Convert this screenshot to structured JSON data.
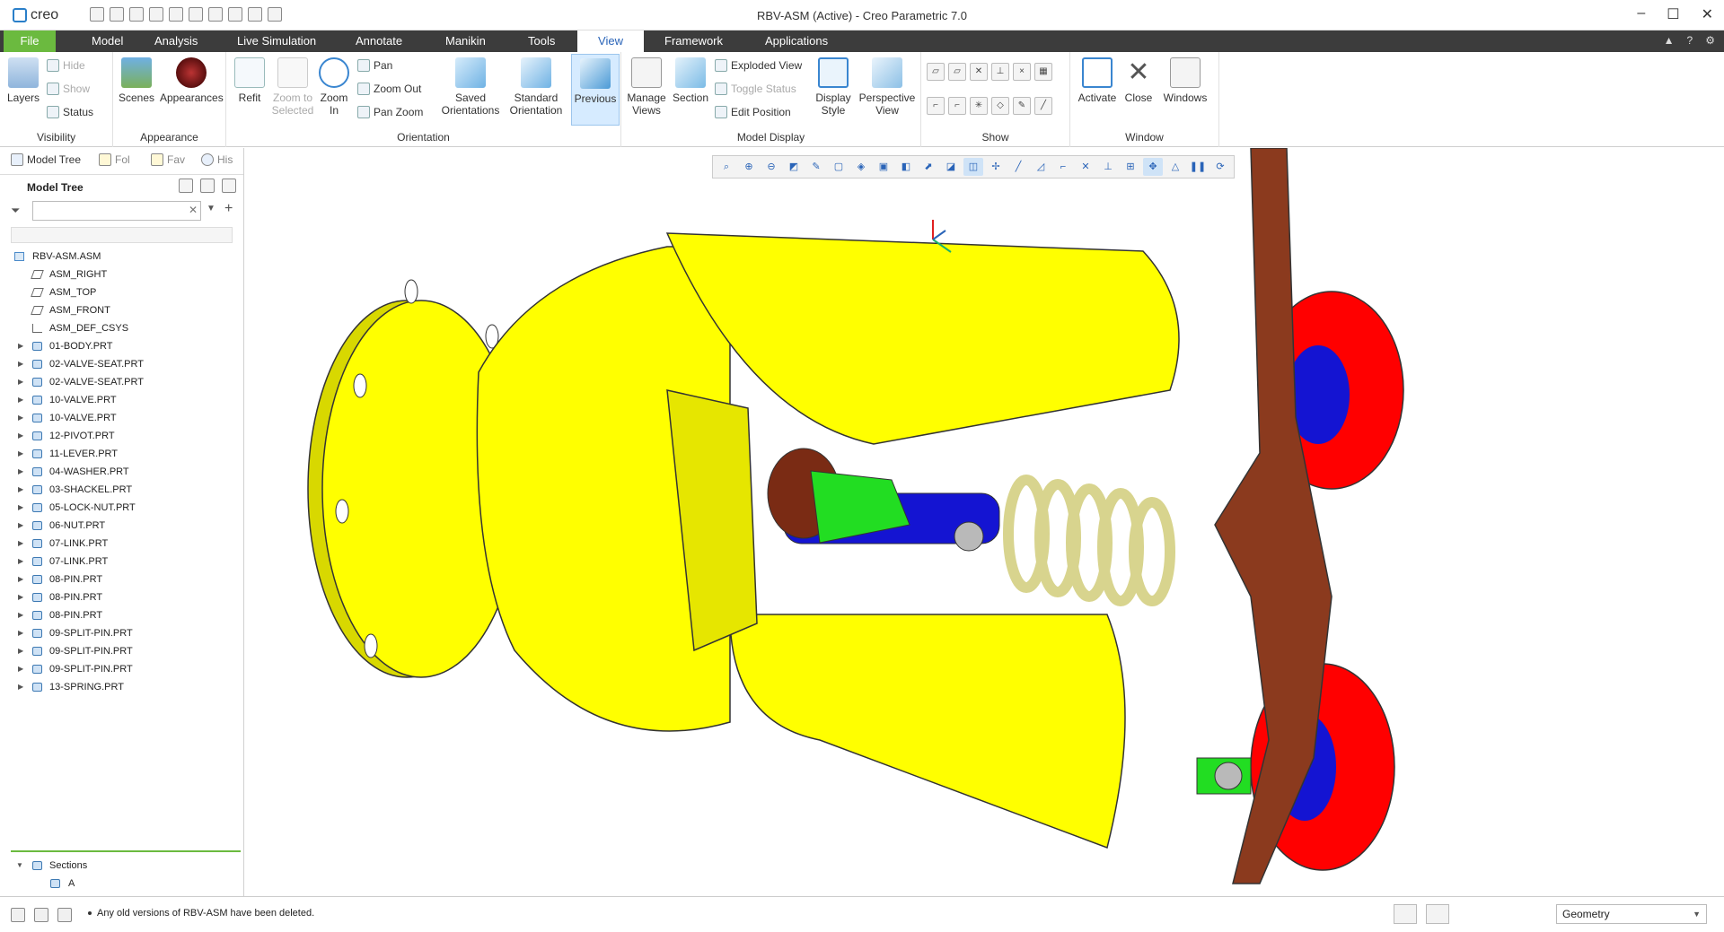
{
  "window": {
    "app_logo": "creo",
    "title": "RBV-ASM (Active) - Creo Parametric 7.0",
    "controls": [
      "–",
      "☐",
      "✕"
    ]
  },
  "menu": {
    "tabs": [
      "File",
      "Model",
      "Analysis",
      "Live Simulation",
      "Annotate",
      "Manikin",
      "Tools",
      "View",
      "Framework",
      "Applications"
    ],
    "active": "View"
  },
  "ribbon": {
    "visibility": {
      "layers": "Layers",
      "hide": "Hide",
      "show": "Show",
      "status": "Status",
      "group_label": "Visibility"
    },
    "appearance": {
      "scenes": "Scenes",
      "appearances": "Appearances",
      "group_label": "Appearance"
    },
    "orientation": {
      "refit": "Refit",
      "zoom_to_selected_1": "Zoom to",
      "zoom_to_selected_2": "Selected",
      "zoom_in_1": "Zoom",
      "zoom_in_2": "In",
      "pan": "Pan",
      "zoom_out": "Zoom Out",
      "pan_zoom": "Pan Zoom",
      "saved_orientations_1": "Saved",
      "saved_orientations_2": "Orientations",
      "standard_orientation_1": "Standard",
      "standard_orientation_2": "Orientation",
      "previous": "Previous",
      "group_label": "Orientation"
    },
    "model_display": {
      "manage_views_1": "Manage",
      "manage_views_2": "Views",
      "section": "Section",
      "exploded_view": "Exploded View",
      "toggle_status": "Toggle Status",
      "edit_position": "Edit Position",
      "display_style_1": "Display",
      "display_style_2": "Style",
      "perspective_view_1": "Perspective",
      "perspective_view_2": "View",
      "group_label": "Model Display"
    },
    "show": {
      "group_label": "Show"
    },
    "window": {
      "activate": "Activate",
      "close": "Close",
      "windows": "Windows",
      "group_label": "Window"
    }
  },
  "navigator": {
    "tabs": [
      "Model Tree",
      "Fol",
      "Fav",
      "His"
    ],
    "tree_title": "Model Tree",
    "filter_placeholder": "",
    "root": "RBV-ASM.ASM",
    "datums": [
      "ASM_RIGHT",
      "ASM_TOP",
      "ASM_FRONT",
      "ASM_DEF_CSYS"
    ],
    "parts": [
      "01-BODY.PRT",
      "02-VALVE-SEAT.PRT",
      "02-VALVE-SEAT.PRT",
      "10-VALVE.PRT",
      "10-VALVE.PRT",
      "12-PIVOT.PRT",
      "11-LEVER.PRT",
      "04-WASHER.PRT",
      "03-SHACKEL.PRT",
      "05-LOCK-NUT.PRT",
      "06-NUT.PRT",
      "07-LINK.PRT",
      "07-LINK.PRT",
      "08-PIN.PRT",
      "08-PIN.PRT",
      "08-PIN.PRT",
      "09-SPLIT-PIN.PRT",
      "09-SPLIT-PIN.PRT",
      "09-SPLIT-PIN.PRT",
      "13-SPRING.PRT"
    ],
    "sections_label": "Sections",
    "section_items": [
      "A"
    ]
  },
  "status": {
    "message": "Any old versions of RBV-ASM have been deleted.",
    "selection_filter": "Geometry"
  },
  "colors": {
    "body": "#ffff00",
    "valve_seat": "#ff0000",
    "lever": "#8b3a1e",
    "valve": "#1414d2",
    "spring": "#f0eeb0",
    "link": "#22dd22",
    "pin": "#b9b9b9",
    "file_tab": "#6bba3f",
    "menubar": "#3c3c3c"
  }
}
